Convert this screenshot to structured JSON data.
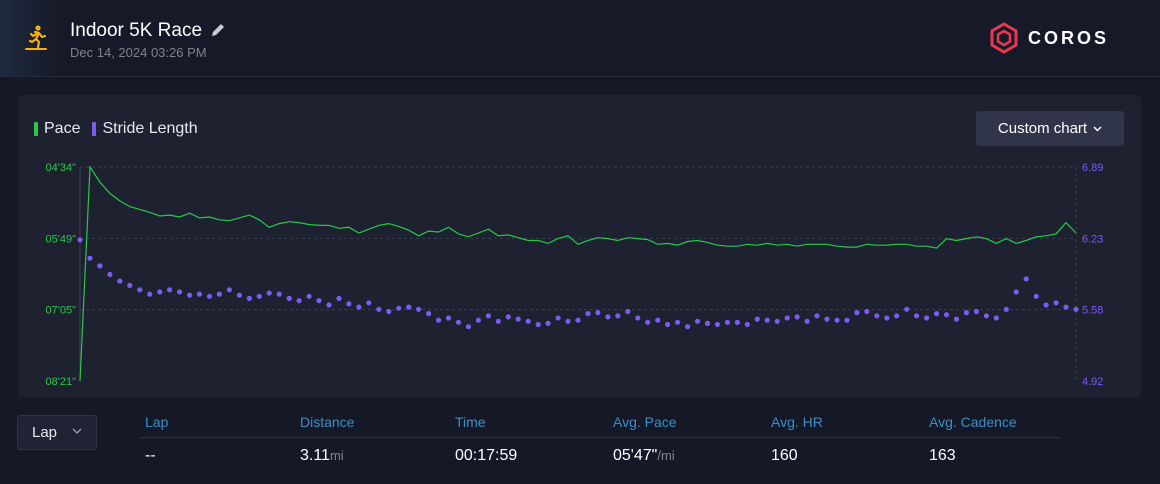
{
  "activity": {
    "icon": "treadmill-runner-icon",
    "title": "Indoor 5K Race",
    "date": "Dec 14, 2024 03:26 PM"
  },
  "brand": {
    "name": "COROS",
    "color": "#e8384f"
  },
  "chart": {
    "legend": [
      {
        "label": "Pace",
        "color": "#28c94a"
      },
      {
        "label": "Stride Length",
        "color": "#7b5cf0"
      }
    ],
    "custom_button_label": "Custom chart"
  },
  "chart_data": {
    "type": "line",
    "x": [
      0,
      1,
      2,
      3,
      4,
      5,
      6,
      7,
      8,
      9,
      10,
      11,
      12,
      13,
      14,
      15,
      16,
      17,
      18,
      19,
      20,
      21,
      22,
      23,
      24,
      25,
      26,
      27,
      28,
      29,
      30,
      31,
      32,
      33,
      34,
      35,
      36,
      37,
      38,
      39,
      40,
      41,
      42,
      43,
      44,
      45,
      46,
      47,
      48,
      49,
      50,
      51,
      52,
      53,
      54,
      55,
      56,
      57,
      58,
      59,
      60,
      61,
      62,
      63,
      64,
      65,
      66,
      67,
      68,
      69,
      70,
      71,
      72,
      73,
      74,
      75,
      76,
      77,
      78,
      79,
      80,
      81,
      82,
      83,
      84,
      85,
      86,
      87,
      88,
      89,
      90,
      91,
      92,
      93,
      94,
      95,
      96,
      97,
      98,
      99,
      100
    ],
    "series": [
      {
        "name": "Pace",
        "axis": "left",
        "color": "#28c94a",
        "values": [
          501,
          274,
          290,
          302,
          310,
          316,
          319,
          322,
          326,
          325,
          327,
          323,
          328,
          327,
          330,
          331,
          328,
          325,
          330,
          338,
          334,
          332,
          333,
          335,
          336,
          336,
          339,
          338,
          344,
          340,
          336,
          334,
          337,
          341,
          347,
          342,
          343,
          338,
          345,
          348,
          344,
          340,
          347,
          346,
          349,
          352,
          352,
          355,
          350,
          347,
          356,
          352,
          349,
          350,
          352,
          349,
          350,
          351,
          356,
          355,
          357,
          353,
          352,
          354,
          357,
          358,
          358,
          356,
          357,
          355,
          357,
          356,
          358,
          356,
          356,
          356,
          358,
          359,
          359,
          356,
          357,
          357,
          356,
          356,
          358,
          358,
          360,
          350,
          352,
          350,
          348,
          350,
          355,
          350,
          355,
          352,
          348,
          347,
          345,
          333,
          344
        ]
      },
      {
        "name": "Stride Length",
        "axis": "right",
        "color": "#7b5cf0",
        "values": [
          6.22,
          6.05,
          5.98,
          5.9,
          5.84,
          5.8,
          5.76,
          5.72,
          5.74,
          5.76,
          5.74,
          5.71,
          5.72,
          5.7,
          5.72,
          5.76,
          5.71,
          5.68,
          5.7,
          5.73,
          5.72,
          5.68,
          5.66,
          5.7,
          5.66,
          5.62,
          5.68,
          5.63,
          5.6,
          5.64,
          5.58,
          5.56,
          5.59,
          5.6,
          5.58,
          5.54,
          5.48,
          5.5,
          5.46,
          5.42,
          5.48,
          5.52,
          5.47,
          5.51,
          5.49,
          5.47,
          5.44,
          5.45,
          5.5,
          5.47,
          5.48,
          5.54,
          5.55,
          5.51,
          5.52,
          5.56,
          5.5,
          5.46,
          5.48,
          5.44,
          5.46,
          5.42,
          5.47,
          5.45,
          5.44,
          5.46,
          5.46,
          5.44,
          5.49,
          5.48,
          5.47,
          5.5,
          5.51,
          5.47,
          5.52,
          5.49,
          5.48,
          5.48,
          5.55,
          5.56,
          5.52,
          5.5,
          5.52,
          5.58,
          5.52,
          5.5,
          5.54,
          5.53,
          5.49,
          5.55,
          5.56,
          5.52,
          5.5,
          5.58,
          5.74,
          5.86,
          5.7,
          5.62,
          5.64,
          5.6,
          5.58
        ]
      }
    ],
    "left_axis": {
      "ticks": [
        "04'34\"",
        "05'49\"",
        "07'05\"",
        "08'21\""
      ],
      "range": [
        274,
        501
      ],
      "reversed": true
    },
    "right_axis": {
      "ticks": [
        "6.89",
        "6.23",
        "5.58",
        "4.92"
      ],
      "range": [
        4.92,
        6.89
      ]
    },
    "grid": true
  },
  "laps": {
    "selector_label": "Lap",
    "headers": [
      "Lap",
      "Distance",
      "Time",
      "Avg. Pace",
      "Avg. HR",
      "Avg. Cadence"
    ],
    "row": {
      "lap": "--",
      "distance": "3.11",
      "distance_unit": "mi",
      "time": "00:17:59",
      "pace": "05'47\"",
      "pace_unit": "/mi",
      "hr": "160",
      "cadence": "163"
    }
  }
}
